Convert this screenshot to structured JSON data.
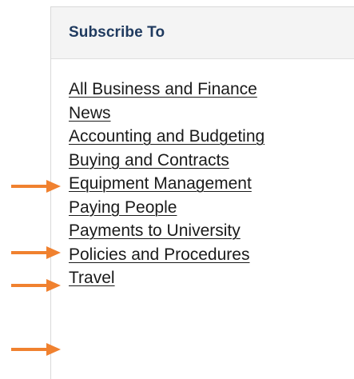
{
  "panel": {
    "title": "Subscribe To",
    "links": [
      {
        "label": "All Business and Finance",
        "arrow": false
      },
      {
        "label": "News",
        "arrow": false
      },
      {
        "label": "Accounting and Budgeting",
        "arrow": false
      },
      {
        "label": "Buying and Contracts",
        "arrow": true
      },
      {
        "label": "Equipment Management",
        "arrow": false
      },
      {
        "label": "Paying People",
        "arrow": true
      },
      {
        "label": "Payments to University",
        "arrow": true
      },
      {
        "label": "Policies and Procedures",
        "arrow": false
      },
      {
        "label": "Travel",
        "arrow": true
      }
    ]
  },
  "colors": {
    "arrow": "#f0812f",
    "title": "#1f3a5f",
    "link": "#1a1a1a",
    "header_bg": "#f4f4f4"
  },
  "icons": {
    "arrow": "right-arrow-icon"
  }
}
